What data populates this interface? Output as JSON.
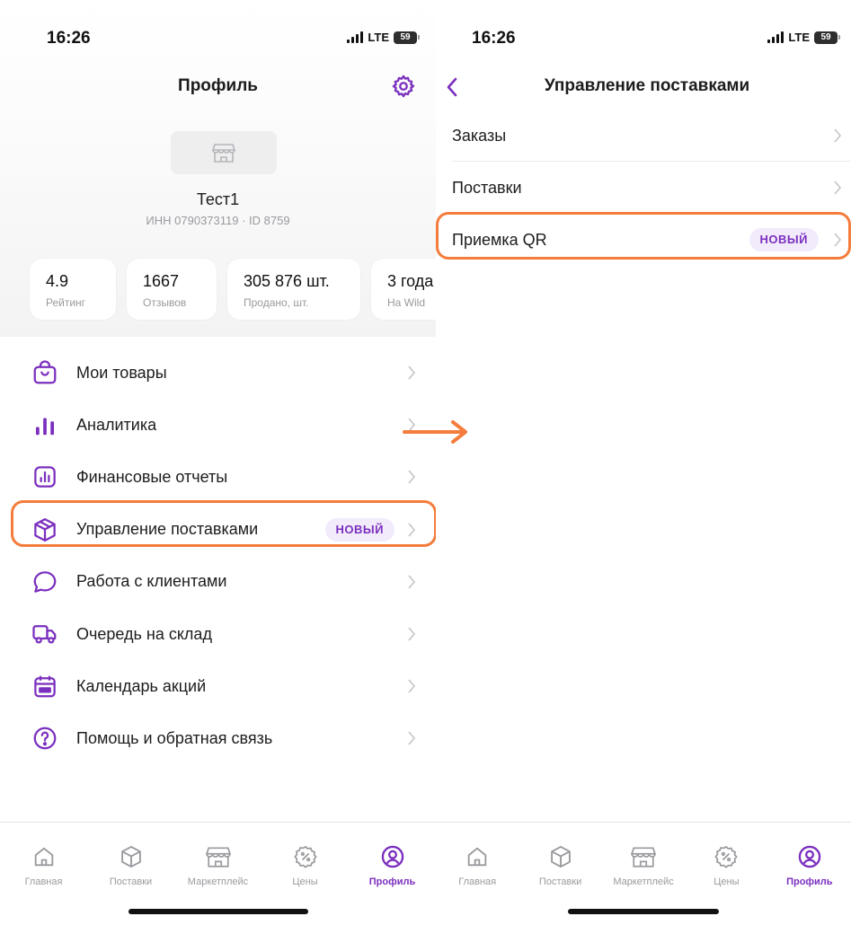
{
  "colors": {
    "accent": "#7b2fbe",
    "highlight": "#f47c3c",
    "muted": "#9a9a9f",
    "badge_bg": "#f1ebfb"
  },
  "status_bar": {
    "time": "16:26",
    "network": "LTE",
    "battery": "59"
  },
  "profile": {
    "title": "Профиль",
    "shop_name": "Тест1",
    "shop_meta": "ИНН 0790373119 · ID 8759",
    "stats": [
      {
        "value": "4.9",
        "label": "Рейтинг"
      },
      {
        "value": "1667",
        "label": "Отзывов"
      },
      {
        "value": "305 876 шт.",
        "label": "Продано, шт."
      },
      {
        "value": "3 года",
        "label": "На Wild"
      }
    ],
    "menu": [
      {
        "label": "Мои товары",
        "icon": "bag-icon"
      },
      {
        "label": "Аналитика",
        "icon": "bar-chart-icon"
      },
      {
        "label": "Финансовые отчеты",
        "icon": "report-icon"
      },
      {
        "label": "Управление поставками",
        "icon": "box-icon",
        "badge": "НОВЫЙ"
      },
      {
        "label": "Работа с клиентами",
        "icon": "chat-bubble-icon"
      },
      {
        "label": "Очередь на склад",
        "icon": "truck-icon"
      },
      {
        "label": "Календарь акций",
        "icon": "sale-calendar-icon"
      },
      {
        "label": "Помощь и обратная связь",
        "icon": "help-icon"
      }
    ]
  },
  "supply": {
    "title": "Управление поставками",
    "items": [
      {
        "label": "Заказы"
      },
      {
        "label": "Поставки"
      },
      {
        "label": "Приемка QR",
        "badge": "НОВЫЙ"
      }
    ]
  },
  "tabbar": {
    "items": [
      {
        "label": "Главная",
        "icon": "home-icon"
      },
      {
        "label": "Поставки",
        "icon": "box-icon"
      },
      {
        "label": "Маркетплейс",
        "icon": "store-icon"
      },
      {
        "label": "Цены",
        "icon": "percent-badge-icon"
      },
      {
        "label": "Профиль",
        "icon": "profile-icon",
        "active": true
      }
    ]
  }
}
